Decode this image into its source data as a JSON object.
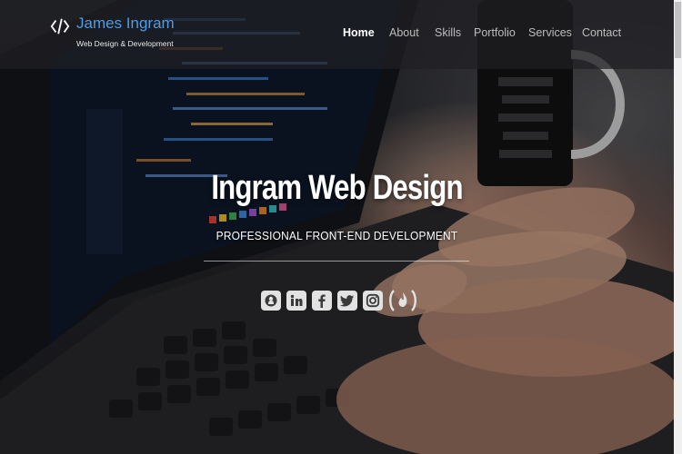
{
  "brand": {
    "name": "James Ingram",
    "tagline": "Web Design & Development",
    "accent_color": "#4d9ce6",
    "icon": "code-brackets-icon"
  },
  "nav": {
    "items": [
      {
        "label": "Home",
        "active": true
      },
      {
        "label": "About",
        "active": false
      },
      {
        "label": "Skills",
        "active": false
      },
      {
        "label": "Portfolio",
        "active": false
      },
      {
        "label": "Services",
        "active": false
      },
      {
        "label": "Contact",
        "active": false
      }
    ]
  },
  "hero": {
    "title": "Ingram Web Design",
    "subtitle": "PROFESSIONAL FRONT-END DEVELOPMENT",
    "background": "laptop-keyboard-photo"
  },
  "socials": [
    {
      "name": "github-icon"
    },
    {
      "name": "linkedin-icon"
    },
    {
      "name": "facebook-icon"
    },
    {
      "name": "twitter-icon"
    },
    {
      "name": "instagram-icon"
    },
    {
      "name": "freecodecamp-icon"
    }
  ]
}
